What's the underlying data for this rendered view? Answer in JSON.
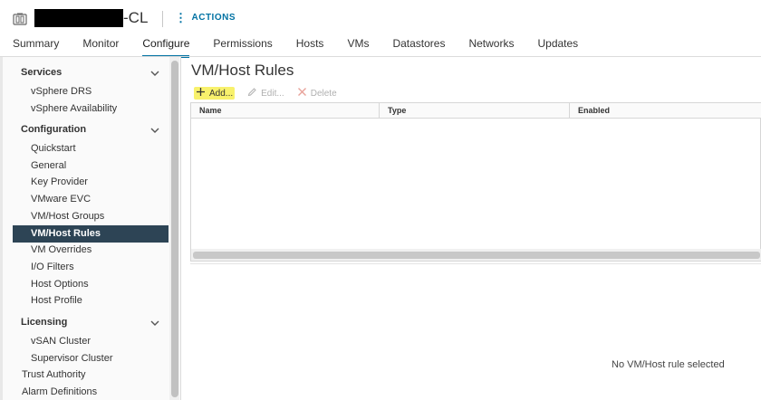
{
  "header": {
    "object_title_suffix": "-CL",
    "actions_label": "ACTIONS"
  },
  "tabs": [
    {
      "label": "Summary"
    },
    {
      "label": "Monitor"
    },
    {
      "label": "Configure",
      "active": true
    },
    {
      "label": "Permissions"
    },
    {
      "label": "Hosts"
    },
    {
      "label": "VMs"
    },
    {
      "label": "Datastores"
    },
    {
      "label": "Networks"
    },
    {
      "label": "Updates"
    }
  ],
  "sidebar": {
    "groups": {
      "services": "Services",
      "configuration": "Configuration",
      "licensing": "Licensing"
    },
    "items": {
      "vsphere_drs": "vSphere DRS",
      "vsphere_availability": "vSphere Availability",
      "quickstart": "Quickstart",
      "general": "General",
      "key_provider": "Key Provider",
      "vmware_evc": "VMware EVC",
      "vm_host_groups": "VM/Host Groups",
      "vm_host_rules": "VM/Host Rules",
      "vm_overrides": "VM Overrides",
      "io_filters": "I/O Filters",
      "host_options": "Host Options",
      "host_profile": "Host Profile",
      "vsan_cluster": "vSAN Cluster",
      "supervisor_cluster": "Supervisor Cluster",
      "trust_authority": "Trust Authority",
      "alarm_definitions": "Alarm Definitions"
    },
    "selected": "VM/Host Rules"
  },
  "main": {
    "title": "VM/Host Rules",
    "toolbar": {
      "add": "Add...",
      "edit": "Edit...",
      "delete": "Delete"
    },
    "grid": {
      "columns": [
        "Name",
        "Type",
        "Enabled"
      ],
      "rows": []
    },
    "detail_empty": "No VM/Host rule selected"
  },
  "colors": {
    "accent": "#0072a3",
    "selected_nav_bg": "#2d4455",
    "highlight": "#f8f16c",
    "delete_icon": "#e8a29a"
  },
  "icons": {
    "object": "cluster-icon",
    "actions": "vertical-dots-icon",
    "add": "plus-icon",
    "edit": "pencil-icon",
    "delete": "delete-x-icon",
    "collapse": "chevron-down-icon"
  }
}
